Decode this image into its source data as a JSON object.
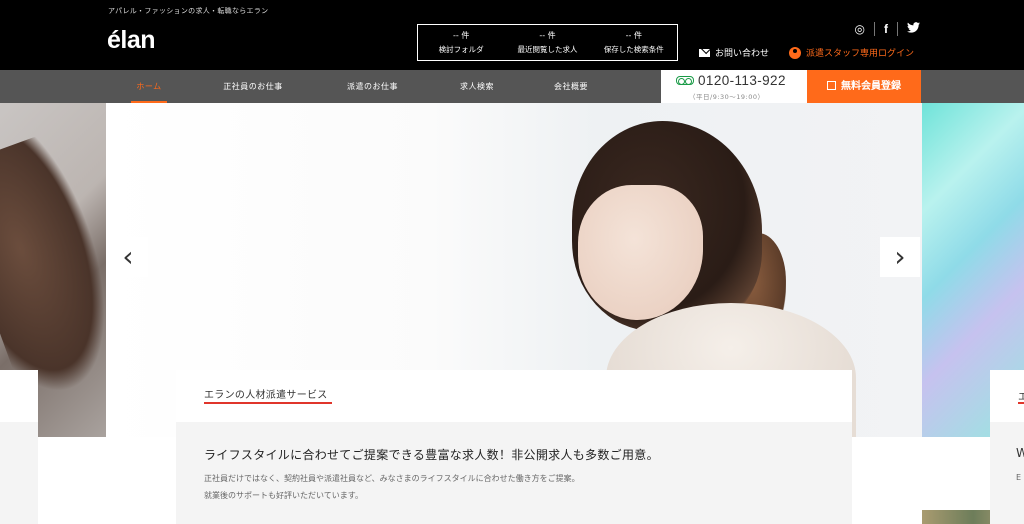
{
  "header": {
    "tagline": "アパレル・ファッションの求人・転職ならエラン",
    "logo": "élan",
    "counters": [
      {
        "num": "-- 件",
        "label": "検討フォルダ"
      },
      {
        "num": "-- 件",
        "label": "最近閲覧した求人"
      },
      {
        "num": "-- 件",
        "label": "保存した検索条件"
      }
    ],
    "social": {
      "instagram": "◎",
      "facebook": "f",
      "twitter": "🐦"
    },
    "contact_label": "お問い合わせ",
    "login_label": "派遣スタッフ専用ログイン"
  },
  "nav": {
    "items": [
      "ホーム",
      "正社員のお仕事",
      "派遣のお仕事",
      "求人検索",
      "会社概要"
    ],
    "active_index": 0,
    "phone": "0120-113-922",
    "phone_hours": "（平日/9:30〜19:00）",
    "register": "無料会員登録"
  },
  "hero": {
    "prev": "‹",
    "next": "›"
  },
  "card": {
    "label": "エランの人材派遣サービス",
    "heading": "ライフスタイルに合わせてご提案できる豊富な求人数！非公開求人も多数ご用意。",
    "text1": "正社員だけではなく、契約社員や派遣社員など、みなさまのライフスタイルに合わせた働き方をご提案。",
    "text2": "就業後のサポートも好評いただいています。"
  },
  "peek": {
    "right_label": "エ",
    "right_heading": "W",
    "right_text": "E"
  }
}
